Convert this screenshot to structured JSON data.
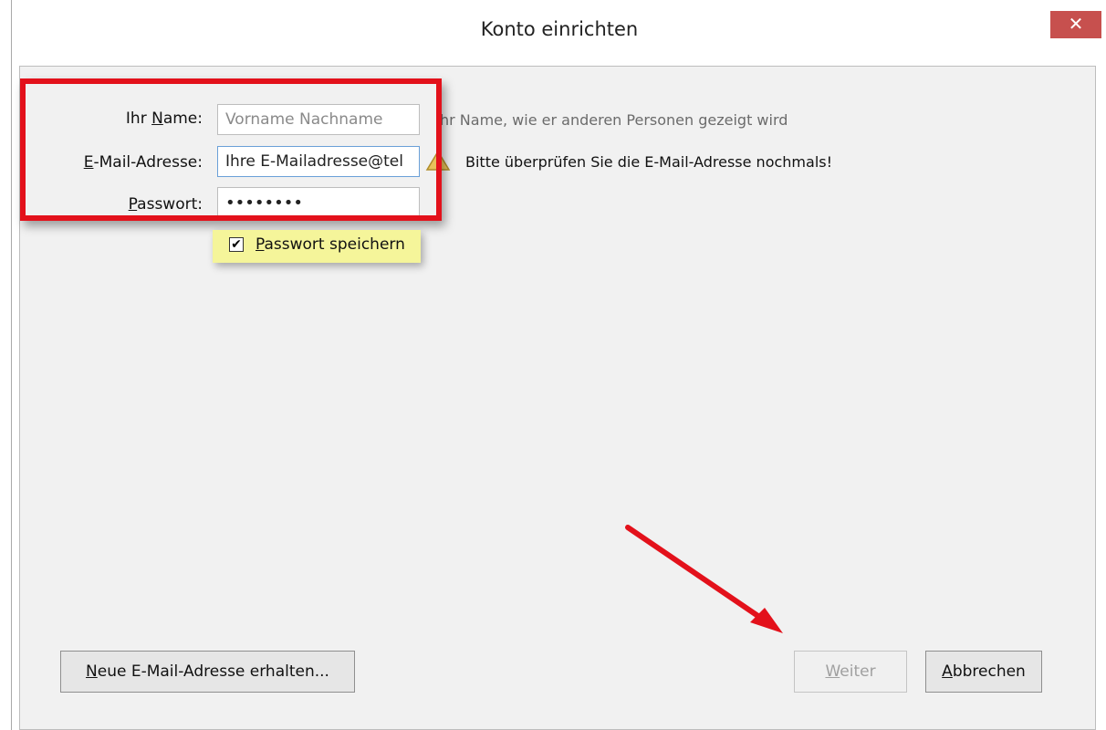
{
  "window": {
    "title": "Konto einrichten",
    "close_glyph": "✕"
  },
  "form": {
    "name_label": "Ihr Name:",
    "name_label_parts": [
      "Ihr ",
      "N",
      "ame:"
    ],
    "name_placeholder": "Vorname Nachname",
    "name_hint": "hr Name, wie er anderen Personen gezeigt wird",
    "email_label_parts": [
      "",
      "E",
      "-Mail-Adresse:"
    ],
    "email_value": "Ihre E-Mailadresse@tel",
    "email_warning": "Bitte überprüfen Sie die E-Mail-Adresse nochmals!",
    "password_label_parts": [
      "",
      "P",
      "asswort:"
    ],
    "password_value": "••••••••",
    "save_password_parts": [
      "",
      "P",
      "asswort speichern"
    ],
    "save_password_checked": true
  },
  "buttons": {
    "new_address_parts": [
      "",
      "N",
      "eue E-Mail-Adresse erhalten..."
    ],
    "next_parts": [
      "",
      "W",
      "eiter"
    ],
    "cancel_parts": [
      "",
      "A",
      "bbrechen"
    ]
  },
  "annotation_colors": {
    "highlight": "#e3111b",
    "checkbox_bg": "#f5f59a",
    "arrow": "#e3111b"
  },
  "icons": [
    "close-icon",
    "warning-icon",
    "checkmark-icon",
    "arrow-annotation"
  ]
}
